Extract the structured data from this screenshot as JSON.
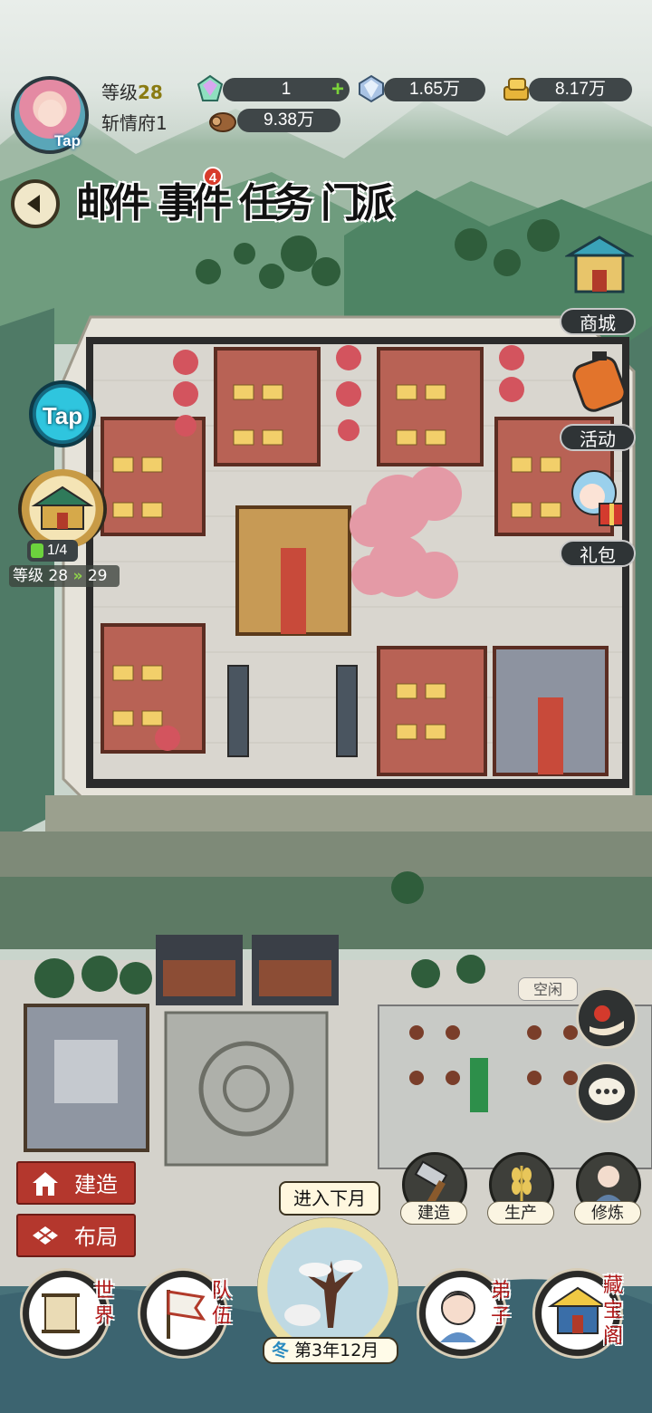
{
  "player": {
    "level_label": "等级",
    "level": "28",
    "residence": "斩情府1",
    "avatar_badge": "Tap"
  },
  "resources": [
    {
      "name": "gem",
      "value": "1",
      "has_plus": true
    },
    {
      "name": "crystal",
      "value": "1.65万"
    },
    {
      "name": "gold",
      "value": "8.17万"
    },
    {
      "name": "wood",
      "value": "9.38万"
    }
  ],
  "tabs": [
    {
      "label": "邮件"
    },
    {
      "label": "事件",
      "badge": "4"
    },
    {
      "label": "任务"
    },
    {
      "label": "门派"
    }
  ],
  "right_menu": [
    {
      "label": "商城",
      "icon": "shop-pavilion-icon"
    },
    {
      "label": "活动",
      "icon": "lantern-icon"
    },
    {
      "label": "礼包",
      "icon": "gift-girl-icon"
    }
  ],
  "sect": {
    "progress": "1/4",
    "level_text": "等级 28",
    "arrow": "»",
    "next_level": "29"
  },
  "tap_button": "Tap",
  "left_buttons": [
    {
      "label": "建造",
      "icon": "house-icon"
    },
    {
      "label": "布局",
      "icon": "layout-grid-icon"
    }
  ],
  "idle_tag": "空闲",
  "action_buttons": [
    {
      "label": "建造",
      "icon": "hammer-icon"
    },
    {
      "label": "生产",
      "icon": "wheat-icon"
    },
    {
      "label": "修炼",
      "icon": "meditating-disciple-icon"
    }
  ],
  "bottom_nav": [
    {
      "label": "世界",
      "icon": "world-scroll-icon"
    },
    {
      "label": "队伍",
      "icon": "team-flag-icon"
    },
    {
      "label": "弟子",
      "icon": "disciple-icon"
    },
    {
      "label": "藏宝阁",
      "icon": "treasure-pavilion-icon"
    }
  ],
  "calendar": {
    "next_month_label": "进入下月",
    "season": "冬",
    "date": "第3年12月"
  },
  "colors": {
    "accent_red": "#b4372d",
    "resource_bar": "#3f4648",
    "plus_green": "#7bd23a",
    "badge_red": "#d83c2c"
  }
}
